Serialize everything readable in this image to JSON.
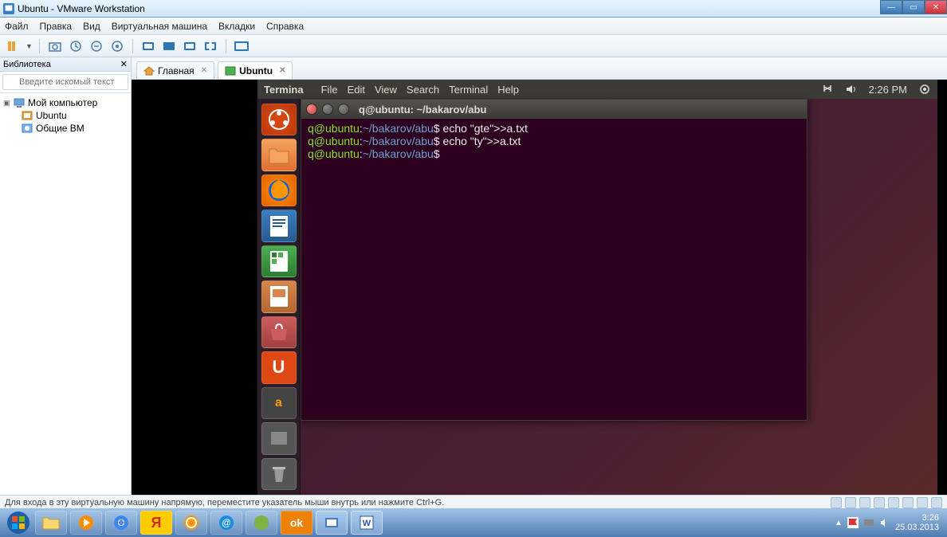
{
  "window": {
    "title": "Ubuntu - VMware Workstation"
  },
  "menubar": {
    "items": [
      "Файл",
      "Правка",
      "Вид",
      "Виртуальная машина",
      "Вкладки",
      "Справка"
    ]
  },
  "library": {
    "title": "Библиотека",
    "search_placeholder": "Введите искомый текст",
    "root": "Мой компьютер",
    "item1": "Ubuntu",
    "item2": "Общие ВМ"
  },
  "vmtabs": {
    "home": "Главная",
    "ubuntu": "Ubuntu"
  },
  "ubuntu_topbar": {
    "app": "Termina",
    "menus": [
      "File",
      "Edit",
      "View",
      "Search",
      "Terminal",
      "Help"
    ],
    "time": "2:26 PM"
  },
  "terminal": {
    "title": "q@ubuntu: ~/bakarov/abu",
    "lines": [
      {
        "user": "q@ubuntu",
        "path": "~/bakarov/abu",
        "cmd": "echo \"gte\">>a.txt"
      },
      {
        "user": "q@ubuntu",
        "path": "~/bakarov/abu",
        "cmd": "echo \"ty\">>a.txt"
      },
      {
        "user": "q@ubuntu",
        "path": "~/bakarov/abu",
        "cmd": ""
      }
    ]
  },
  "statusbar": {
    "text": "Для входа в эту виртуальную машину напрямую, переместите указатель мыши внутрь или нажмите Ctrl+G."
  },
  "win_taskbar": {
    "time": "3:26",
    "date": "25.03.2013"
  }
}
